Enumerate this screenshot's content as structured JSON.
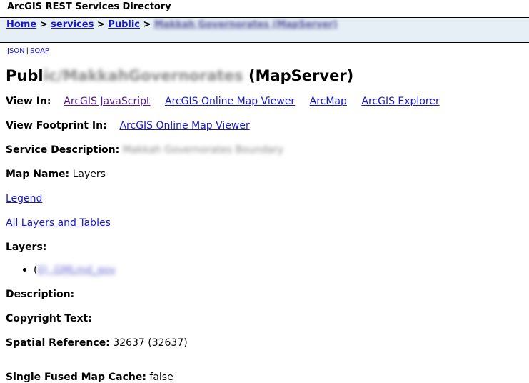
{
  "header": {
    "title": "ArcGIS REST Services Directory"
  },
  "breadcrumb": {
    "home": "Home",
    "services": "services",
    "public": "Public",
    "current": "Makkah Governorates (MapServer)",
    "separator": ">"
  },
  "formats": {
    "json": "JSON",
    "pipe": "|",
    "soap": "SOAP"
  },
  "page_title": {
    "prefix": "Publ",
    "hidden": "ic/MakkahGovernorates",
    "suffix": " (MapServer)"
  },
  "view_in": {
    "label": "View In:",
    "links": [
      "ArcGIS JavaScript",
      "ArcGIS Online Map Viewer",
      "ArcMap",
      "ArcGIS Explorer"
    ]
  },
  "view_footprint": {
    "label": "View Footprint In:",
    "link": "ArcGIS Online Map Viewer"
  },
  "service_description": {
    "label": "Service Description:",
    "value": "Makkah Governorates Boundary"
  },
  "map_name": {
    "label": "Map Name:",
    "value": "Layers"
  },
  "legend_link": "Legend",
  "all_layers_link": "All Layers and Tables",
  "layers": {
    "label": "Layers:",
    "item_prefix": "(",
    "item_hidden": "0) .GMLmd_gov"
  },
  "description": {
    "label": "Description:"
  },
  "copyright": {
    "label": "Copyright Text:"
  },
  "spatial_reference": {
    "label": "Spatial Reference:",
    "value": "32637  (32637)"
  },
  "fused_cache": {
    "label": "Single Fused Map Cache:",
    "value": "false"
  }
}
